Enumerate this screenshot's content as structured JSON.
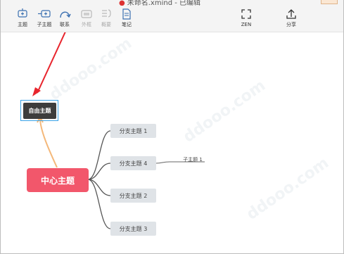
{
  "window": {
    "title": "未命名.xmind - 已编辑"
  },
  "toolbar": {
    "topic": "主题",
    "subtopic": "子主题",
    "relation": "联系",
    "boundary": "外框",
    "summary": "概要",
    "note": "笔记",
    "zen": "ZEN",
    "share": "分享"
  },
  "map": {
    "central": "中心主题",
    "free_topic": "自由主题",
    "branches": [
      "分支主题 1",
      "分支主题 4",
      "分支主题 2",
      "分支主题 3"
    ],
    "subtopic": "子主题 1"
  },
  "colors": {
    "central": "#f2576b",
    "free_topic": "#3d3d3d",
    "branch": "#dfe3e7",
    "relation_line": "#f4b87a",
    "arrow": "#e8252d",
    "selection": "#3aa3e8"
  }
}
